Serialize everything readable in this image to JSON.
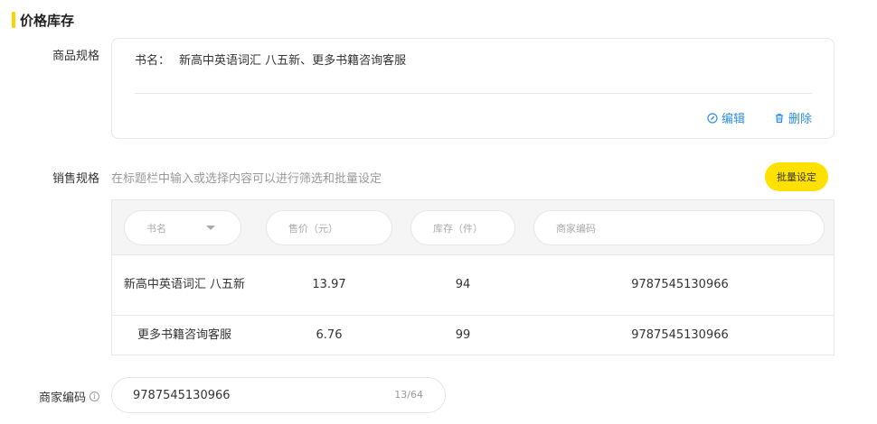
{
  "section": {
    "title": "价格库存"
  },
  "product_spec": {
    "label": "商品规格",
    "key": "书名：",
    "value": "新高中英语词汇 八五新、更多书籍咨询客服",
    "edit_label": "编辑",
    "delete_label": "删除"
  },
  "sales_spec": {
    "label": "销售规格",
    "hint": "在标题栏中输入或选择内容可以进行筛选和批量设定",
    "batch_label": "批量设定",
    "filters": {
      "name": "书名",
      "price": "售价（元）",
      "stock": "库存（件）",
      "code": "商家编码"
    },
    "rows": [
      {
        "name": "新高中英语词汇 八五新",
        "price": "13.97",
        "stock": "94",
        "code": "9787545130966"
      },
      {
        "name": "更多书籍咨询客服",
        "price": "6.76",
        "stock": "99",
        "code": "9787545130966"
      }
    ]
  },
  "merchant_code": {
    "label": "商家编码",
    "value": "9787545130966",
    "count": "13/64"
  },
  "colors": {
    "accent": "#ffd200",
    "button": "#ffe100",
    "link": "#2f8fe8"
  }
}
